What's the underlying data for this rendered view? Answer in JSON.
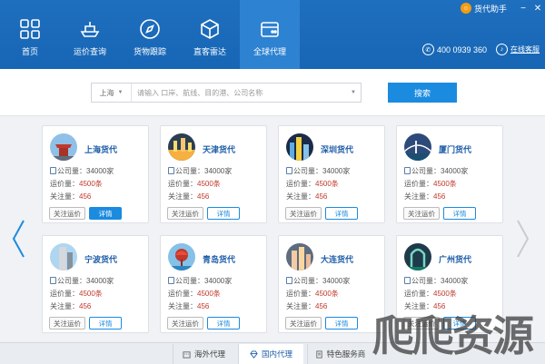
{
  "app": {
    "brand": "货代助手",
    "phone": "400 0939 360",
    "help_link": "在线客服"
  },
  "nav": [
    {
      "label": "首页",
      "icon": "grid-icon"
    },
    {
      "label": "运价查询",
      "icon": "ship-icon"
    },
    {
      "label": "货物跟踪",
      "icon": "compass-icon"
    },
    {
      "label": "直客雷达",
      "icon": "package-icon"
    },
    {
      "label": "全球代理",
      "icon": "agent-icon",
      "active": true
    }
  ],
  "search": {
    "city": "上海",
    "placeholder": "请输入 口岸、航线、目的港、公司名称",
    "button": "搜索"
  },
  "cards": [
    {
      "name": "上海货代",
      "company": "公司量：34000家",
      "freight_label": "运价量：",
      "freight_value": "4500条",
      "follow_label": "关注量：",
      "follow_value": "456",
      "btn_follow": "关注运价",
      "btn_detail": "详情",
      "primary": true
    },
    {
      "name": "天津货代",
      "company": "公司量：34000家",
      "freight_label": "运价量：",
      "freight_value": "4500条",
      "follow_label": "关注量：",
      "follow_value": "456",
      "btn_follow": "关注运价",
      "btn_detail": "详情"
    },
    {
      "name": "深圳货代",
      "company": "公司量：34000家",
      "freight_label": "运价量：",
      "freight_value": "4500条",
      "follow_label": "关注量：",
      "follow_value": "456",
      "btn_follow": "关注运价",
      "btn_detail": "详情"
    },
    {
      "name": "厦门货代",
      "company": "公司量：34000家",
      "freight_label": "运价量：",
      "freight_value": "4500条",
      "follow_label": "关注量：",
      "follow_value": "456",
      "btn_follow": "关注运价",
      "btn_detail": "详情"
    },
    {
      "name": "宁波货代",
      "company": "公司量：34000家",
      "freight_label": "运价量：",
      "freight_value": "4500条",
      "follow_label": "关注量：",
      "follow_value": "456",
      "btn_follow": "关注运价",
      "btn_detail": "详情"
    },
    {
      "name": "青岛货代",
      "company": "公司量：34000家",
      "freight_label": "运价量：",
      "freight_value": "4500条",
      "follow_label": "关注量：",
      "follow_value": "456",
      "btn_follow": "关注运价",
      "btn_detail": "详情"
    },
    {
      "name": "大连货代",
      "company": "公司量：34000家",
      "freight_label": "运价量：",
      "freight_value": "4500条",
      "follow_label": "关注量：",
      "follow_value": "456",
      "btn_follow": "关注运价",
      "btn_detail": "详情"
    },
    {
      "name": "广州货代",
      "company": "公司量：34000家",
      "freight_label": "运价量：",
      "freight_value": "4500条",
      "follow_label": "关注量：",
      "follow_value": "456",
      "btn_follow": "关注运价",
      "btn_detail": "详情"
    }
  ],
  "tabs": [
    {
      "label": "海外代理",
      "icon": "building-icon"
    },
    {
      "label": "国内代理",
      "icon": "diamond-icon",
      "active": true
    },
    {
      "label": "特色服务商",
      "icon": "doc-icon"
    }
  ],
  "watermark": "爬爬资源",
  "colors": {
    "header": "#1766b5",
    "active_nav": "#2d82d1",
    "accent": "#1b8be0",
    "value_red": "#c0392b"
  }
}
